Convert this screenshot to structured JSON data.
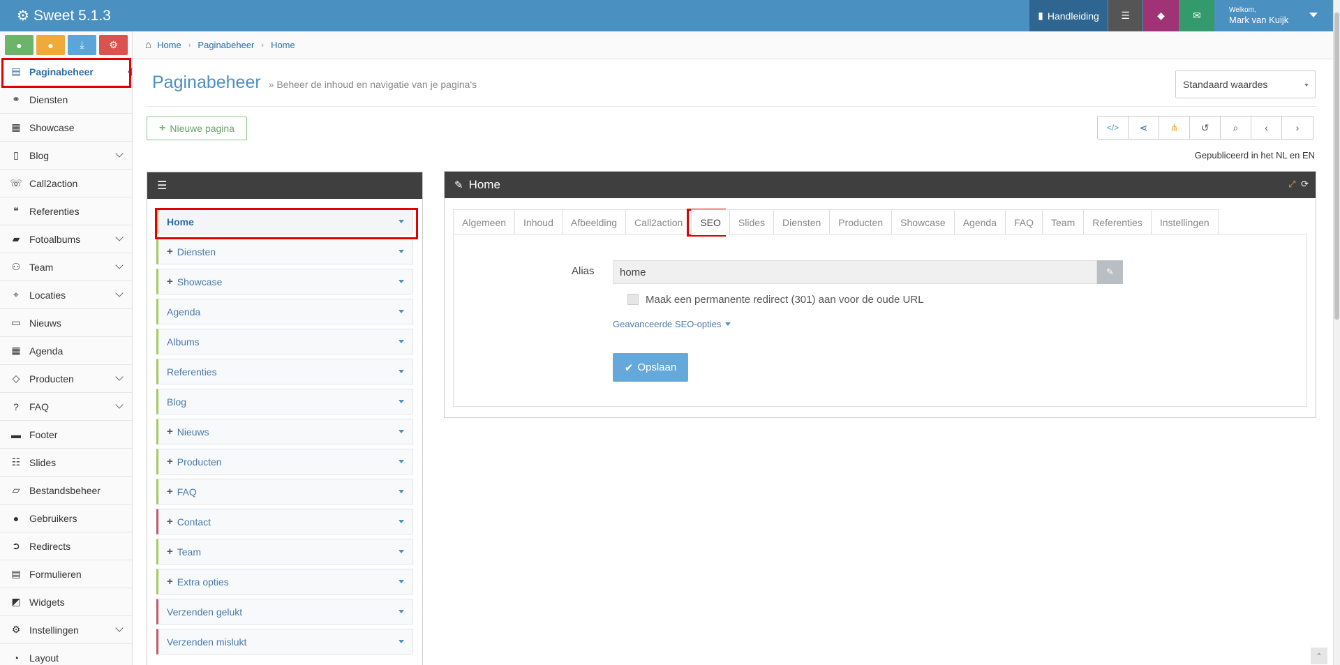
{
  "app": {
    "title": "Sweet 5.1.3"
  },
  "topbar": {
    "manual_label": "Handleiding",
    "welcome": "Welkom,",
    "user_name": "Mark van Kuijk"
  },
  "sidebar": {
    "quick_buttons": [
      "location-icon",
      "user-icon",
      "download-icon",
      "settings-icon"
    ],
    "items": [
      {
        "label": "Paginabeheer",
        "icon": "table-icon",
        "active": true,
        "chevron": false
      },
      {
        "label": "Diensten",
        "icon": "services-icon",
        "chevron": false
      },
      {
        "label": "Showcase",
        "icon": "grid-icon",
        "chevron": false
      },
      {
        "label": "Blog",
        "icon": "document-icon",
        "chevron": true
      },
      {
        "label": "Call2action",
        "icon": "phone-icon",
        "chevron": false
      },
      {
        "label": "Referenties",
        "icon": "comments-icon",
        "chevron": false
      },
      {
        "label": "Fotoalbums",
        "icon": "book-icon",
        "chevron": true
      },
      {
        "label": "Team",
        "icon": "team-icon",
        "chevron": true
      },
      {
        "label": "Locaties",
        "icon": "map-marker-icon",
        "chevron": true
      },
      {
        "label": "Nieuws",
        "icon": "newspaper-icon",
        "chevron": false
      },
      {
        "label": "Agenda",
        "icon": "calendar-icon",
        "chevron": false
      },
      {
        "label": "Producten",
        "icon": "tags-icon",
        "chevron": true
      },
      {
        "label": "FAQ",
        "icon": "question-icon",
        "chevron": true
      },
      {
        "label": "Footer",
        "icon": "footer-icon",
        "chevron": false
      },
      {
        "label": "Slides",
        "icon": "sliders-icon",
        "chevron": false
      },
      {
        "label": "Bestandsbeheer",
        "icon": "folder-icon",
        "chevron": false
      },
      {
        "label": "Gebruikers",
        "icon": "user-icon",
        "chevron": false
      },
      {
        "label": "Redirects",
        "icon": "redirect-icon",
        "chevron": false
      },
      {
        "label": "Formulieren",
        "icon": "form-icon",
        "chevron": false
      },
      {
        "label": "Widgets",
        "icon": "widget-icon",
        "chevron": false
      },
      {
        "label": "Instellingen",
        "icon": "gear-icon",
        "chevron": true
      },
      {
        "label": "Layout",
        "icon": "palette-icon",
        "chevron": false
      }
    ]
  },
  "breadcrumb": [
    "Home",
    "Paginabeheer",
    "Home"
  ],
  "page": {
    "title": "Paginabeheer",
    "subtitle": "» Beheer de inhoud en navigatie van je pagina's",
    "select_value": "Standaard waardes",
    "new_page_label": "Nieuwe pagina",
    "published_text": "Gepubliceerd in het NL en EN"
  },
  "tree": {
    "items": [
      {
        "label": "Home",
        "plus": false,
        "color": "green",
        "home": true
      },
      {
        "label": "Diensten",
        "plus": true,
        "color": "green"
      },
      {
        "label": "Showcase",
        "plus": true,
        "color": "green"
      },
      {
        "label": "Agenda",
        "plus": false,
        "color": "green"
      },
      {
        "label": "Albums",
        "plus": false,
        "color": "green"
      },
      {
        "label": "Referenties",
        "plus": false,
        "color": "green"
      },
      {
        "label": "Blog",
        "plus": false,
        "color": "green"
      },
      {
        "label": "Nieuws",
        "plus": true,
        "color": "green"
      },
      {
        "label": "Producten",
        "plus": true,
        "color": "green"
      },
      {
        "label": "FAQ",
        "plus": true,
        "color": "green"
      },
      {
        "label": "Contact",
        "plus": true,
        "color": "red"
      },
      {
        "label": "Team",
        "plus": true,
        "color": "green"
      },
      {
        "label": "Extra opties",
        "plus": true,
        "color": "green"
      },
      {
        "label": "Verzenden gelukt",
        "plus": false,
        "color": "red"
      },
      {
        "label": "Verzenden mislukt",
        "plus": false,
        "color": "red"
      }
    ]
  },
  "editor": {
    "title": "Home",
    "tabs": [
      "Algemeen",
      "Inhoud",
      "Afbeelding",
      "Call2action",
      "SEO",
      "Slides",
      "Diensten",
      "Producten",
      "Showcase",
      "Agenda",
      "FAQ",
      "Team",
      "Referenties",
      "Instellingen"
    ],
    "active_tab": "SEO",
    "alias_label": "Alias",
    "alias_value": "home",
    "redirect_label": "Maak een permanente redirect (301) aan voor de oude URL",
    "advanced_label": "Geavanceerde SEO-opties",
    "save_label": "Opslaan"
  }
}
